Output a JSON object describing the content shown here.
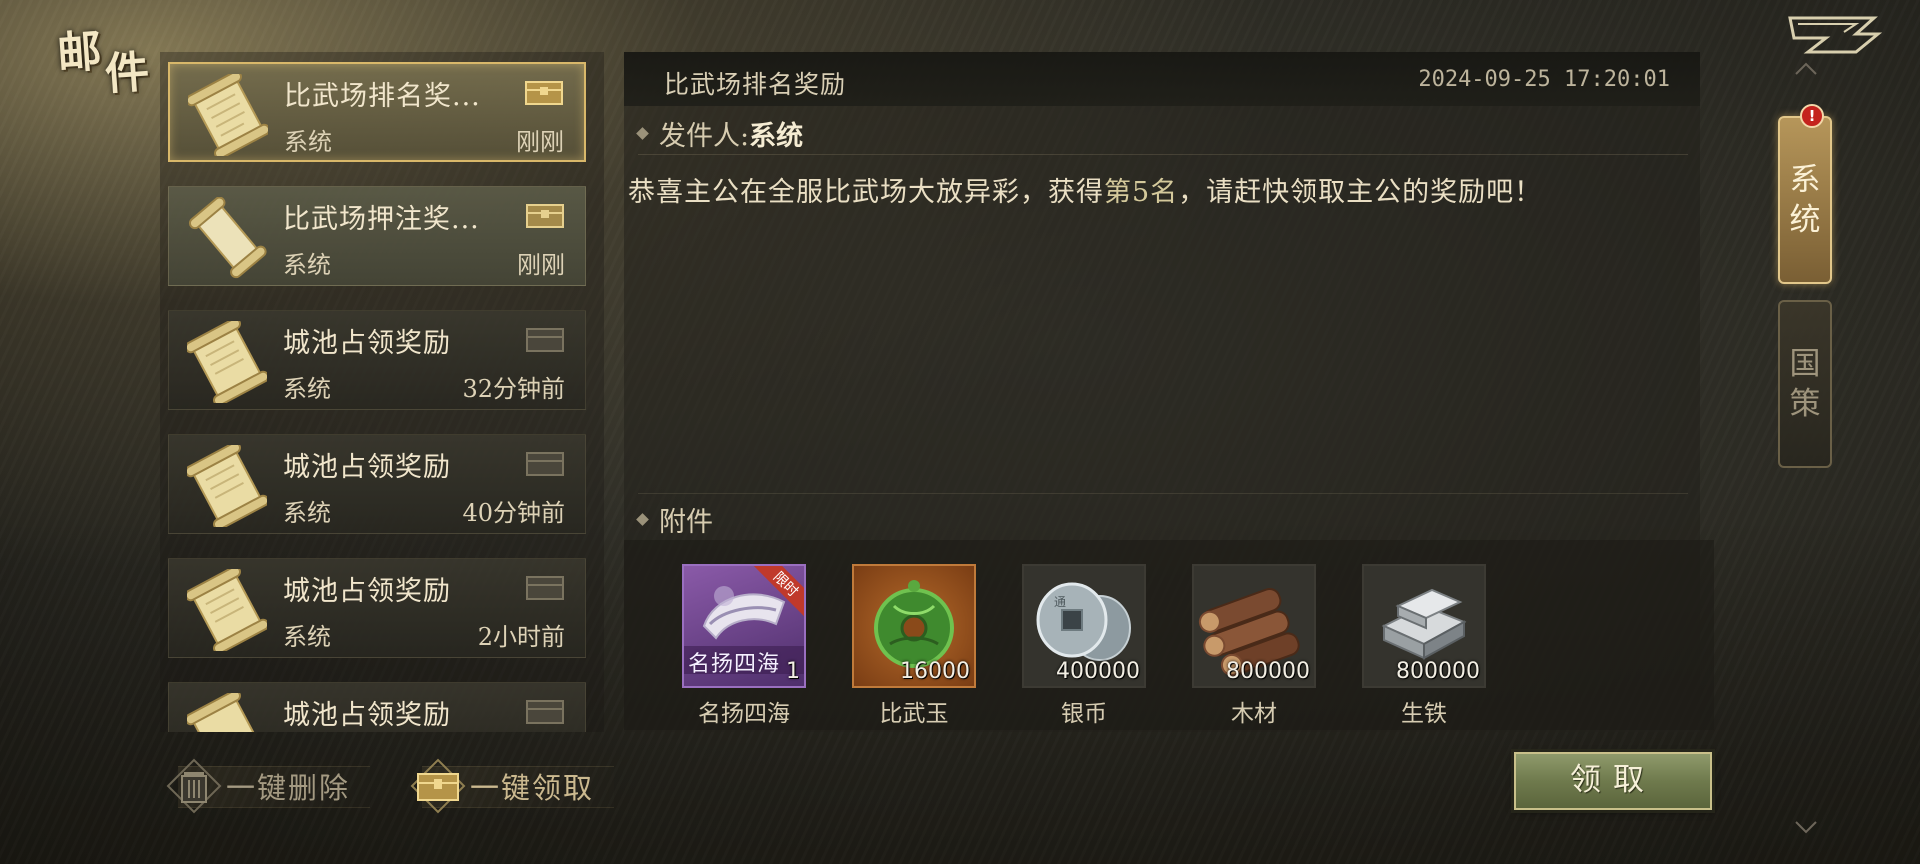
{
  "page": {
    "title": "邮件"
  },
  "mail_list": [
    {
      "title": "比武场排名奖...",
      "sender": "系统",
      "time": "刚刚",
      "state": "selected"
    },
    {
      "title": "比武场押注奖...",
      "sender": "系统",
      "time": "刚刚",
      "state": "read"
    },
    {
      "title": "城池占领奖励",
      "sender": "系统",
      "time": "32分钟前",
      "state": "normal"
    },
    {
      "title": "城池占领奖励",
      "sender": "系统",
      "time": "40分钟前",
      "state": "normal"
    },
    {
      "title": "城池占领奖励",
      "sender": "系统",
      "time": "2小时前",
      "state": "normal"
    },
    {
      "title": "城池占领奖励",
      "sender": "",
      "time": "",
      "state": "normal"
    }
  ],
  "actions": {
    "delete_all": "一键删除",
    "claim_all": "一键领取",
    "claim": "领取"
  },
  "detail": {
    "title": "比武场排名奖励",
    "date": "2024-09-25 17:20:01",
    "sender_label": "发件人:",
    "sender_value": "系统",
    "body_before": "恭喜主公在全服比武场大放异彩，获得",
    "body_highlight": "第5名",
    "body_after": "，请赶快领取主公的奖励吧！",
    "attachments_label": "附件",
    "attachments": [
      {
        "name": "名扬四海",
        "count": "1",
        "tag": "限时",
        "icon_text": "名扬四海",
        "icon": "horn-icon"
      },
      {
        "name": "比武玉",
        "count": "16000",
        "icon": "jade-icon"
      },
      {
        "name": "银币",
        "count": "400000",
        "icon": "coin-icon"
      },
      {
        "name": "木材",
        "count": "800000",
        "icon": "wood-icon"
      },
      {
        "name": "生铁",
        "count": "800000",
        "icon": "iron-icon"
      }
    ]
  },
  "tabs": [
    {
      "label": "系统",
      "active": true,
      "badge": "!"
    },
    {
      "label": "国策",
      "active": false
    }
  ],
  "colors": {
    "accent_gold": "#d9b86a",
    "claim_green": "#6f7a4d",
    "badge_red": "#c4231d"
  }
}
